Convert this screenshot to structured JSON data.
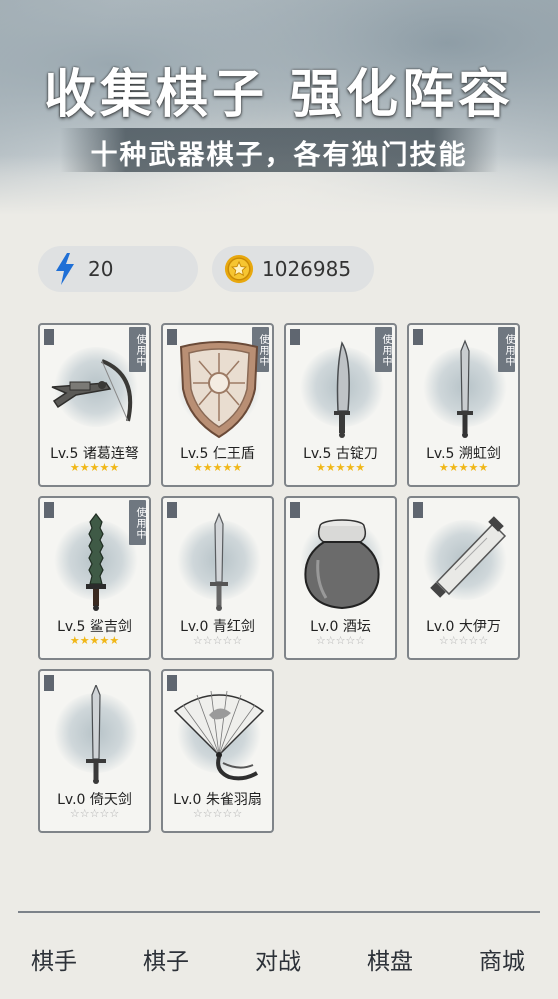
{
  "header": {
    "title": "收集棋子 强化阵容",
    "subtitle": "十种武器棋子，各有独门技能"
  },
  "resources": {
    "energy": "20",
    "coins": "1026985",
    "energy_icon": "lightning-icon",
    "coin_icon": "gold-coin-star-icon",
    "energy_color": "#1f6fd6",
    "coin_color": "#f2b515"
  },
  "cards": [
    {
      "name": "Lv.5 诸葛连弩",
      "stars": 5,
      "in_use": "使用中",
      "icon": "crossbow-icon"
    },
    {
      "name": "Lv.5 仁王盾",
      "stars": 5,
      "in_use": "使用中",
      "icon": "shield-icon"
    },
    {
      "name": "Lv.5 古锭刀",
      "stars": 5,
      "in_use": "使用中",
      "icon": "broadsword-icon"
    },
    {
      "name": "Lv.5 溯虹剑",
      "stars": 5,
      "in_use": "使用中",
      "icon": "sword-icon"
    },
    {
      "name": "Lv.5 鲨吉剑",
      "stars": 5,
      "in_use": "使用中",
      "icon": "jagged-sword-icon"
    },
    {
      "name": "Lv.0 青红剑",
      "stars": 0,
      "icon": "sword-icon"
    },
    {
      "name": "Lv.0 酒坛",
      "stars": 0,
      "icon": "wine-jar-icon"
    },
    {
      "name": "Lv.0 大伊万",
      "stars": 0,
      "icon": "scroll-icon"
    },
    {
      "name": "Lv.0 倚天剑",
      "stars": 0,
      "icon": "long-sword-icon"
    },
    {
      "name": "Lv.0 朱雀羽扇",
      "stars": 0,
      "icon": "feather-fan-icon"
    }
  ],
  "nav": [
    {
      "label": "棋手"
    },
    {
      "label": "棋子"
    },
    {
      "label": "对战"
    },
    {
      "label": "棋盘"
    },
    {
      "label": "商城"
    }
  ]
}
